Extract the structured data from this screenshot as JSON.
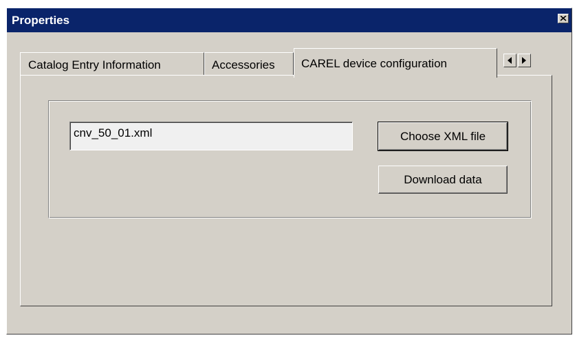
{
  "window": {
    "title": "Properties",
    "close_icon": "close-icon"
  },
  "tabs": [
    {
      "label": "Catalog Entry Information",
      "active": false
    },
    {
      "label": "Accessories",
      "active": false
    },
    {
      "label": "CAREL device configuration",
      "active": true
    }
  ],
  "tab_scroll": {
    "left_icon": "triangle-left-icon",
    "right_icon": "triangle-right-icon"
  },
  "config": {
    "file_value": "cnv_50_01.xml",
    "choose_button": "Choose XML file",
    "download_button": "Download data"
  },
  "colors": {
    "titlebar": "#0a246a",
    "face": "#d4d0c8",
    "input_bg": "#f0f0f0"
  }
}
